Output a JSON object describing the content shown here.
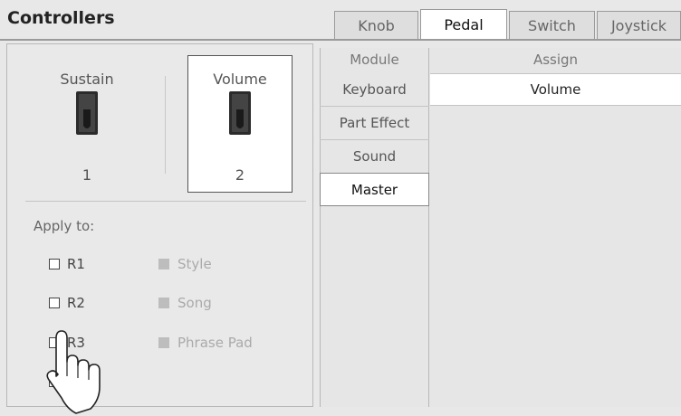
{
  "header": {
    "title": "Controllers",
    "tabs": [
      {
        "label": "Knob",
        "active": false
      },
      {
        "label": "Pedal",
        "active": true
      },
      {
        "label": "Switch",
        "active": false
      },
      {
        "label": "Joystick",
        "active": false
      }
    ]
  },
  "pedals": [
    {
      "name": "Sustain",
      "number": "1",
      "selected": false
    },
    {
      "name": "Volume",
      "number": "2",
      "selected": true
    }
  ],
  "apply": {
    "label": "Apply to:",
    "parts": [
      {
        "label": "R1",
        "checked": false
      },
      {
        "label": "R2",
        "checked": false
      },
      {
        "label": "R3",
        "checked": false
      },
      {
        "label": "",
        "checked": false
      }
    ],
    "disabled_options": [
      "Style",
      "Song",
      "Phrase Pad"
    ]
  },
  "module": {
    "header": "Module",
    "items": [
      "Keyboard",
      "Part Effect",
      "Sound",
      "Master"
    ],
    "selected": "Master"
  },
  "assign": {
    "header": "Assign",
    "value": "Volume"
  },
  "colors": {
    "active_tab": "#ffffff",
    "inactive_tab": "#dedede",
    "background": "#e8e8e8"
  }
}
